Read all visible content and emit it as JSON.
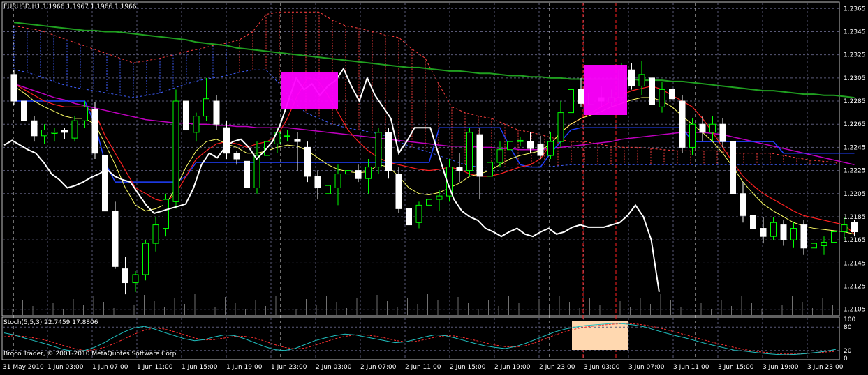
{
  "header": {
    "symbol_info": "EURUSD,H1  1.1966 1.1967 1.1966 1.1966"
  },
  "subwindow": {
    "indicator_label": "Stoch(5,5,3) 22.7459 17.8806",
    "scale_labels": [
      "100",
      "80",
      "20",
      "0"
    ]
  },
  "copyright": "Broco Trader, © 2001-2010 MetaQuotes Software Corp.",
  "colors": {
    "background": "#000000",
    "grid": "#5a5a78",
    "bull_candle": "#00ff00",
    "bear_candle": "#ffffff",
    "green_ma": "#20a020",
    "magenta_ma": "#c000c0",
    "red_line": "#ff2020",
    "blue_line": "#2040ff",
    "yellow_line": "#ffff66",
    "white_line": "#ffffff",
    "kumo_red": "#ff4040",
    "kumo_blue": "#4060ff",
    "highlight_magenta": "#ff00ff",
    "highlight_peach": "#ffd8b0",
    "stoch_main": "#20c0c0",
    "stoch_signal": "#ff3030"
  },
  "chart_data": [
    {
      "type": "candlestick",
      "symbol": "EURUSD",
      "timeframe": "H1",
      "y_ticks": [
        "1.2365",
        "1.2345",
        "1.2325",
        "1.2305",
        "1.2285",
        "1.2265",
        "1.2245",
        "1.2225",
        "1.2205",
        "1.2185",
        "1.2165",
        "1.2145",
        "1.2125",
        "1.2105"
      ],
      "ylim": [
        1.21,
        1.237
      ],
      "x_ticks": [
        "31 May 2010",
        "1 Jun 03:00",
        "1 Jun 07:00",
        "1 Jun 11:00",
        "1 Jun 15:00",
        "1 Jun 19:00",
        "1 Jun 23:00",
        "2 Jun 03:00",
        "2 Jun 07:00",
        "2 Jun 11:00",
        "2 Jun 15:00",
        "2 Jun 19:00",
        "2 Jun 23:00",
        "3 Jun 03:00",
        "3 Jun 07:00",
        "3 Jun 11:00",
        "3 Jun 15:00",
        "3 Jun 19:00",
        "3 Jun 23:00"
      ],
      "grid": true,
      "candles": [
        [
          1.2308,
          1.2312,
          1.2282,
          1.2285
        ],
        [
          1.2285,
          1.229,
          1.2262,
          1.2268
        ],
        [
          1.2268,
          1.2272,
          1.225,
          1.2255
        ],
        [
          1.2255,
          1.2265,
          1.2248,
          1.226
        ],
        [
          1.2257,
          1.2262,
          1.225,
          1.2258
        ],
        [
          1.226,
          1.2262,
          1.2252,
          1.2258
        ],
        [
          1.2253,
          1.2272,
          1.225,
          1.2268
        ],
        [
          1.2268,
          1.2285,
          1.2262,
          1.228
        ],
        [
          1.2278,
          1.2284,
          1.2235,
          1.224
        ],
        [
          1.2238,
          1.2245,
          1.218,
          1.219
        ],
        [
          1.219,
          1.2198,
          1.214,
          1.2142
        ],
        [
          1.214,
          1.215,
          1.2118,
          1.2128
        ],
        [
          1.2128,
          1.2138,
          1.212,
          1.2135
        ],
        [
          1.2135,
          1.2165,
          1.213,
          1.2162
        ],
        [
          1.2162,
          1.2185,
          1.2155,
          1.2178
        ],
        [
          1.2175,
          1.2205,
          1.2168,
          1.22
        ],
        [
          1.2198,
          1.2295,
          1.2192,
          1.2285
        ],
        [
          1.2285,
          1.2292,
          1.2255,
          1.226
        ],
        [
          1.2258,
          1.2275,
          1.225,
          1.2272
        ],
        [
          1.2272,
          1.2305,
          1.2268,
          1.2287
        ],
        [
          1.2285,
          1.229,
          1.226,
          1.2265
        ],
        [
          1.2262,
          1.2268,
          1.2235,
          1.224
        ],
        [
          1.224,
          1.2242,
          1.223,
          1.2235
        ],
        [
          1.2233,
          1.2238,
          1.2205,
          1.221
        ],
        [
          1.221,
          1.225,
          1.2205,
          1.2238
        ],
        [
          1.2238,
          1.2255,
          1.2225,
          1.225
        ],
        [
          1.2248,
          1.2262,
          1.224,
          1.2258
        ],
        [
          1.2255,
          1.226,
          1.225,
          1.2255
        ],
        [
          1.2252,
          1.2258,
          1.2225,
          1.225
        ],
        [
          1.2245,
          1.225,
          1.2215,
          1.222
        ],
        [
          1.222,
          1.2225,
          1.22,
          1.221
        ],
        [
          1.2205,
          1.2222,
          1.218,
          1.2212
        ],
        [
          1.221,
          1.223,
          1.2195,
          1.2222
        ],
        [
          1.2222,
          1.224,
          1.22,
          1.2225
        ],
        [
          1.2225,
          1.223,
          1.2215,
          1.2218
        ],
        [
          1.2218,
          1.2235,
          1.2205,
          1.2228
        ],
        [
          1.2228,
          1.2262,
          1.2222,
          1.2258
        ],
        [
          1.2258,
          1.2262,
          1.2218,
          1.2225
        ],
        [
          1.2222,
          1.2228,
          1.2188,
          1.2192
        ],
        [
          1.2192,
          1.2205,
          1.217,
          1.2178
        ],
        [
          1.218,
          1.2198,
          1.2175,
          1.2195
        ],
        [
          1.2195,
          1.221,
          1.2185,
          1.22
        ],
        [
          1.22,
          1.2208,
          1.219,
          1.2203
        ],
        [
          1.2203,
          1.2235,
          1.2198,
          1.2228
        ],
        [
          1.2228,
          1.224,
          1.2215,
          1.2225
        ],
        [
          1.2225,
          1.2262,
          1.222,
          1.2258
        ],
        [
          1.2256,
          1.2262,
          1.22,
          1.222
        ],
        [
          1.222,
          1.2238,
          1.221,
          1.2232
        ],
        [
          1.2232,
          1.225,
          1.2228,
          1.2243
        ],
        [
          1.2243,
          1.2258,
          1.224,
          1.225
        ],
        [
          1.225,
          1.2254,
          1.2246,
          1.2251
        ],
        [
          1.225,
          1.2258,
          1.224,
          1.2244
        ],
        [
          1.2248,
          1.2255,
          1.2235,
          1.2238
        ],
        [
          1.2238,
          1.2258,
          1.2235,
          1.225
        ],
        [
          1.225,
          1.2285,
          1.2245,
          1.2275
        ],
        [
          1.2275,
          1.23,
          1.227,
          1.2295
        ],
        [
          1.2295,
          1.2305,
          1.228,
          1.2283
        ],
        [
          1.2282,
          1.2296,
          1.2276,
          1.2292
        ],
        [
          1.2288,
          1.2298,
          1.228,
          1.2285
        ],
        [
          1.2284,
          1.2295,
          1.228,
          1.2288
        ],
        [
          1.2288,
          1.2318,
          1.2285,
          1.2312
        ],
        [
          1.2312,
          1.2318,
          1.2295,
          1.2298
        ],
        [
          1.2298,
          1.232,
          1.229,
          1.2308
        ],
        [
          1.2305,
          1.231,
          1.2278,
          1.2282
        ],
        [
          1.228,
          1.2302,
          1.2275,
          1.2295
        ],
        [
          1.2295,
          1.23,
          1.228,
          1.2287
        ],
        [
          1.2285,
          1.229,
          1.224,
          1.2245
        ],
        [
          1.2245,
          1.227,
          1.2238,
          1.2265
        ],
        [
          1.2265,
          1.2272,
          1.225,
          1.2258
        ],
        [
          1.2258,
          1.2272,
          1.225,
          1.2265
        ],
        [
          1.2265,
          1.227,
          1.2245,
          1.225
        ],
        [
          1.225,
          1.2255,
          1.22,
          1.2205
        ],
        [
          1.2205,
          1.2215,
          1.218,
          1.2186
        ],
        [
          1.2186,
          1.2196,
          1.217,
          1.2175
        ],
        [
          1.2175,
          1.2185,
          1.2162,
          1.2168
        ],
        [
          1.2168,
          1.2185,
          1.2165,
          1.218
        ],
        [
          1.2178,
          1.2182,
          1.216,
          1.2165
        ],
        [
          1.2165,
          1.218,
          1.2158,
          1.2175
        ],
        [
          1.2178,
          1.2182,
          1.2152,
          1.2158
        ],
        [
          1.2158,
          1.2165,
          1.215,
          1.2162
        ],
        [
          1.216,
          1.2168,
          1.2152,
          1.2163
        ],
        [
          1.2163,
          1.218,
          1.2158,
          1.2172
        ],
        [
          1.2172,
          1.2185,
          1.2165,
          1.2178
        ],
        [
          1.218,
          1.2182,
          1.2168,
          1.2172
        ]
      ],
      "white_line": [
        1.2247,
        1.2251,
        1.2247,
        1.2243,
        1.224,
        1.2232,
        1.2222,
        1.2217,
        1.221,
        1.2212,
        1.2215,
        1.2219,
        1.2222,
        1.2226,
        1.222,
        1.2217,
        1.2215,
        1.2205,
        1.2195,
        1.2188,
        1.219,
        1.2192,
        1.2194,
        1.2196,
        1.221,
        1.223,
        1.224,
        1.2236,
        1.2245,
        1.225,
        1.2252,
        1.2245,
        1.2235,
        1.2242,
        1.225,
        1.2265,
        1.2285,
        1.2305,
        1.2295,
        1.23,
        1.229,
        1.2298,
        1.2303,
        1.2313,
        1.2298,
        1.2285,
        1.2305,
        1.229,
        1.228,
        1.227,
        1.224,
        1.225,
        1.2262,
        1.2262,
        1.2262,
        1.224,
        1.2218,
        1.22,
        1.219,
        1.2185,
        1.2182,
        1.2175,
        1.2172,
        1.2168,
        1.2172,
        1.2175,
        1.217,
        1.2168,
        1.2172,
        1.2175,
        1.217,
        1.2172,
        1.2176,
        1.2178,
        1.2176,
        1.2176,
        1.2176,
        1.2178,
        1.218,
        1.2186,
        1.2195,
        1.2185,
        1.2165,
        1.212
      ],
      "green_ma": [
        1.2353,
        1.2352,
        1.2351,
        1.235,
        1.2349,
        1.2348,
        1.2347,
        1.2346,
        1.2346,
        1.2345,
        1.2345,
        1.2344,
        1.2343,
        1.2342,
        1.2341,
        1.234,
        1.2339,
        1.2338,
        1.2336,
        1.2335,
        1.2334,
        1.2333,
        1.2331,
        1.233,
        1.2329,
        1.2328,
        1.2327,
        1.2326,
        1.2325,
        1.2324,
        1.2323,
        1.2322,
        1.2321,
        1.232,
        1.2319,
        1.2318,
        1.2317,
        1.2316,
        1.2315,
        1.2314,
        1.2314,
        1.2313,
        1.2312,
        1.2311,
        1.2311,
        1.231,
        1.2309,
        1.2309,
        1.2308,
        1.2307,
        1.2307,
        1.2306,
        1.2306,
        1.2305,
        1.2305,
        1.2304,
        1.2304,
        1.2304,
        1.2304,
        1.2304,
        1.2304,
        1.2304,
        1.2303,
        1.2303,
        1.2303,
        1.2302,
        1.2302,
        1.2301,
        1.23,
        1.2299,
        1.2298,
        1.2297,
        1.2296,
        1.2295,
        1.2294,
        1.2294,
        1.2293,
        1.2292,
        1.2291,
        1.2291,
        1.229,
        1.229,
        1.2289,
        1.2288
      ],
      "magenta_ma": [
        1.23,
        1.2297,
        1.2294,
        1.2291,
        1.2288,
        1.2286,
        1.2283,
        1.2281,
        1.2279,
        1.2277,
        1.2275,
        1.2273,
        1.2271,
        1.2269,
        1.2268,
        1.2267,
        1.2266,
        1.2266,
        1.2265,
        1.2265,
        1.2264,
        1.2264,
        1.2263,
        1.2263,
        1.2262,
        1.2262,
        1.2262,
        1.2262,
        1.2261,
        1.226,
        1.2259,
        1.2258,
        1.2257,
        1.2256,
        1.2255,
        1.2254,
        1.2253,
        1.2252,
        1.2251,
        1.225,
        1.2249,
        1.2248,
        1.2247,
        1.2246,
        1.2246,
        1.2246,
        1.2245,
        1.2245,
        1.2244,
        1.2244,
        1.2243,
        1.2243,
        1.2243,
        1.2244,
        1.2245,
        1.2246,
        1.2247,
        1.2248,
        1.2249,
        1.225,
        1.2252,
        1.2253,
        1.2254,
        1.2255,
        1.2256,
        1.2257,
        1.2258,
        1.2258,
        1.2258,
        1.2257,
        1.2256,
        1.2254,
        1.2252,
        1.225,
        1.2248,
        1.2246,
        1.2244,
        1.2242,
        1.224,
        1.2238,
        1.2236,
        1.2234,
        1.2232,
        1.223
      ],
      "red_line": [
        1.23,
        1.2295,
        1.229,
        1.2285,
        1.2282,
        1.228,
        1.228,
        1.228,
        1.2275,
        1.2255,
        1.224,
        1.2225,
        1.221,
        1.2205,
        1.22,
        1.2198,
        1.2205,
        1.222,
        1.2235,
        1.2242,
        1.2248,
        1.225,
        1.2248,
        1.2245,
        1.2248,
        1.225,
        1.2255,
        1.227,
        1.229,
        1.2305,
        1.2303,
        1.229,
        1.2275,
        1.226,
        1.225,
        1.2242,
        1.2236,
        1.2232,
        1.223,
        1.2228,
        1.2226,
        1.2225,
        1.2226,
        1.2228,
        1.2226,
        1.2222,
        1.222,
        1.222,
        1.2222,
        1.2225,
        1.2228,
        1.223,
        1.2235,
        1.2248,
        1.2258,
        1.2265,
        1.227,
        1.2275,
        1.228,
        1.2285,
        1.229,
        1.2294,
        1.2296,
        1.2298,
        1.2295,
        1.229,
        1.2285,
        1.228,
        1.227,
        1.2258,
        1.2245,
        1.2232,
        1.222,
        1.2212,
        1.2205,
        1.22,
        1.2195,
        1.219,
        1.2186,
        1.2184,
        1.2182,
        1.218,
        1.2178,
        1.217
      ],
      "blue_line": [
        1.2285,
        1.2285,
        1.2285,
        1.2285,
        1.2285,
        1.2285,
        1.2285,
        1.2285,
        1.2265,
        1.2232,
        1.2215,
        1.2215,
        1.2215,
        1.2215,
        1.2215,
        1.2215,
        1.2215,
        1.222,
        1.2232,
        1.2232,
        1.2232,
        1.2232,
        1.2232,
        1.2232,
        1.2232,
        1.2232,
        1.2232,
        1.2232,
        1.2232,
        1.2232,
        1.2232,
        1.2232,
        1.2232,
        1.2232,
        1.2232,
        1.2232,
        1.2232,
        1.2232,
        1.2232,
        1.2232,
        1.2232,
        1.2232,
        1.2262,
        1.2262,
        1.2262,
        1.2262,
        1.2262,
        1.2262,
        1.2262,
        1.2245,
        1.223,
        1.2228,
        1.2228,
        1.224,
        1.225,
        1.226,
        1.2262,
        1.2262,
        1.2262,
        1.2262,
        1.2262,
        1.2262,
        1.2262,
        1.2262,
        1.2262,
        1.2262,
        1.2262,
        1.225,
        1.225,
        1.225,
        1.225,
        1.225,
        1.225,
        1.225,
        1.225,
        1.225,
        1.224,
        1.224,
        1.224,
        1.224,
        1.224,
        1.224,
        1.224,
        1.224
      ],
      "yellow_line": [
        1.2298,
        1.2292,
        1.2285,
        1.228,
        1.2276,
        1.2272,
        1.227,
        1.227,
        1.2265,
        1.2248,
        1.223,
        1.221,
        1.2195,
        1.219,
        1.2192,
        1.2196,
        1.221,
        1.2228,
        1.2242,
        1.225,
        1.2252,
        1.2248,
        1.2245,
        1.224,
        1.224,
        1.2242,
        1.2245,
        1.2247,
        1.2246,
        1.2242,
        1.2236,
        1.223,
        1.2226,
        1.2224,
        1.2223,
        1.2224,
        1.223,
        1.2228,
        1.222,
        1.221,
        1.2205,
        1.2204,
        1.2206,
        1.221,
        1.2214,
        1.222,
        1.2222,
        1.2225,
        1.223,
        1.2235,
        1.2238,
        1.224,
        1.2242,
        1.2248,
        1.2258,
        1.2265,
        1.227,
        1.2273,
        1.2276,
        1.228,
        1.2283,
        1.2286,
        1.2288,
        1.2288,
        1.2285,
        1.228,
        1.2272,
        1.2265,
        1.2258,
        1.225,
        1.224,
        1.2228,
        1.2215,
        1.2205,
        1.2196,
        1.219,
        1.2185,
        1.218,
        1.2177,
        1.2175,
        1.2174,
        1.2173,
        1.2172,
        1.217
      ]
    },
    {
      "type": "line",
      "name": "Stoch(5,5,3)",
      "main_value": 22.7459,
      "signal_value": 17.8806,
      "ylim": [
        0,
        100
      ],
      "main": [
        65,
        60,
        52,
        45,
        38,
        30,
        22,
        18,
        20,
        28,
        40,
        55,
        68,
        78,
        82,
        75,
        66,
        58,
        50,
        45,
        48,
        55,
        60,
        58,
        50,
        40,
        30,
        22,
        20,
        25,
        35,
        45,
        52,
        58,
        62,
        60,
        55,
        50,
        45,
        40,
        42,
        48,
        55,
        60,
        58,
        52,
        45,
        38,
        32,
        28,
        25,
        30,
        38,
        48,
        58,
        68,
        75,
        80,
        84,
        86,
        88,
        90,
        88,
        85,
        80,
        72,
        65,
        58,
        52,
        45,
        38,
        32,
        26,
        20,
        18,
        15,
        12,
        10,
        9,
        10,
        12,
        15,
        18,
        23
      ],
      "signal": [
        55,
        58,
        56,
        52,
        47,
        40,
        32,
        25,
        20,
        22,
        28,
        38,
        50,
        62,
        72,
        78,
        75,
        68,
        60,
        52,
        47,
        48,
        52,
        56,
        56,
        52,
        44,
        35,
        28,
        24,
        26,
        33,
        42,
        50,
        56,
        60,
        60,
        57,
        52,
        46,
        42,
        43,
        48,
        54,
        58,
        57,
        52,
        46,
        40,
        34,
        30,
        29,
        32,
        40,
        50,
        60,
        68,
        75,
        80,
        83,
        86,
        88,
        89,
        88,
        85,
        80,
        74,
        67,
        60,
        53,
        46,
        39,
        33,
        27,
        22,
        18,
        15,
        13,
        11,
        11,
        12,
        14,
        16,
        18
      ]
    }
  ]
}
